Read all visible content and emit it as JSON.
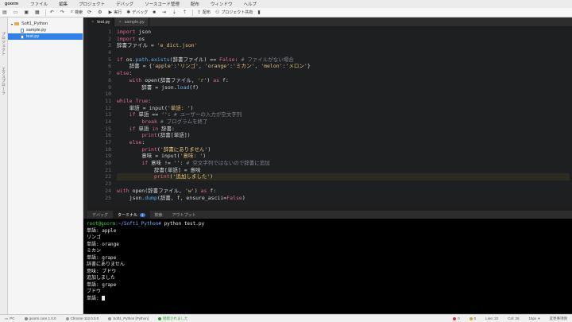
{
  "menubar": {
    "logo": "goorm",
    "items": [
      "ファイル",
      "編集",
      "プロジェクト",
      "デバッグ",
      "ソースコード管理",
      "配布",
      "ウィンドウ",
      "ヘルプ"
    ]
  },
  "toolbar": {
    "search_label": "検索",
    "run_label": "実行",
    "debug_label": "デバッグ",
    "deploy_label": "配布",
    "share_label": "プロジェクト共有"
  },
  "leftrail": {
    "project_label": "プロジェクト",
    "explorer_label": "エクスプローラ"
  },
  "explorer": {
    "folder": "Soft1_Python",
    "files": [
      "sample.py",
      "test.py"
    ],
    "selected": "test.py"
  },
  "editor": {
    "tabs": [
      {
        "label": "test.py"
      },
      {
        "label": "sample.py"
      }
    ],
    "line_numbers": [
      "1",
      "2",
      "3",
      "4",
      "5",
      "6",
      "7",
      "8",
      "9",
      "10",
      "11",
      "12",
      "13",
      "14",
      "15",
      "16",
      "17",
      "18",
      "19",
      "20",
      "21",
      "22",
      "23",
      "24",
      "25"
    ],
    "current_line": 22,
    "lines": [
      [
        {
          "t": "import",
          "c": "k"
        },
        {
          "t": " json",
          "c": "p"
        }
      ],
      [
        {
          "t": "import",
          "c": "k"
        },
        {
          "t": " os",
          "c": "p"
        }
      ],
      [
        {
          "t": "辞書ファイル = ",
          "c": "p"
        },
        {
          "t": "'e_dict.json'",
          "c": "s"
        }
      ],
      [],
      [
        {
          "t": "if",
          "c": "k"
        },
        {
          "t": " os.",
          "c": "p"
        },
        {
          "t": "path",
          "c": "f"
        },
        {
          "t": ".",
          "c": "p"
        },
        {
          "t": "exists",
          "c": "f"
        },
        {
          "t": "(辞書ファイル) == ",
          "c": "p"
        },
        {
          "t": "False",
          "c": "k"
        },
        {
          "t": ": ",
          "c": "p"
        },
        {
          "t": "# ファイルがない場合",
          "c": "c"
        }
      ],
      [
        {
          "t": "    辞書 = {",
          "c": "p"
        },
        {
          "t": "'apple'",
          "c": "s"
        },
        {
          "t": ":",
          "c": "p"
        },
        {
          "t": "'リンゴ'",
          "c": "s"
        },
        {
          "t": ", ",
          "c": "p"
        },
        {
          "t": "'orange'",
          "c": "s"
        },
        {
          "t": ":",
          "c": "p"
        },
        {
          "t": "'ミカン'",
          "c": "s"
        },
        {
          "t": ", ",
          "c": "p"
        },
        {
          "t": "'melon'",
          "c": "s"
        },
        {
          "t": ":",
          "c": "p"
        },
        {
          "t": "'メロン'",
          "c": "s"
        },
        {
          "t": "}",
          "c": "p"
        }
      ],
      [
        {
          "t": "else",
          "c": "k"
        },
        {
          "t": ":",
          "c": "p"
        }
      ],
      [
        {
          "t": "    ",
          "c": "p"
        },
        {
          "t": "with",
          "c": "k"
        },
        {
          "t": " open(辞書ファイル, ",
          "c": "p"
        },
        {
          "t": "'r'",
          "c": "s"
        },
        {
          "t": ") ",
          "c": "p"
        },
        {
          "t": "as",
          "c": "k"
        },
        {
          "t": " f:",
          "c": "p"
        }
      ],
      [
        {
          "t": "        辞書 = json.",
          "c": "p"
        },
        {
          "t": "load",
          "c": "f"
        },
        {
          "t": "(f)",
          "c": "p"
        }
      ],
      [],
      [
        {
          "t": "while",
          "c": "k"
        },
        {
          "t": " ",
          "c": "p"
        },
        {
          "t": "True",
          "c": "k"
        },
        {
          "t": ":",
          "c": "p"
        }
      ],
      [
        {
          "t": "    単語 = input(",
          "c": "p"
        },
        {
          "t": "'単語: '",
          "c": "s"
        },
        {
          "t": ")",
          "c": "p"
        }
      ],
      [
        {
          "t": "    ",
          "c": "p"
        },
        {
          "t": "if",
          "c": "k"
        },
        {
          "t": " 単語 == ",
          "c": "p"
        },
        {
          "t": "''",
          "c": "s"
        },
        {
          "t": ": ",
          "c": "p"
        },
        {
          "t": "# ユーザーの入力が空文字列",
          "c": "c"
        }
      ],
      [
        {
          "t": "        ",
          "c": "p"
        },
        {
          "t": "break",
          "c": "k"
        },
        {
          "t": " ",
          "c": "p"
        },
        {
          "t": "# プログラムを終了",
          "c": "c"
        }
      ],
      [
        {
          "t": "    ",
          "c": "p"
        },
        {
          "t": "if",
          "c": "k"
        },
        {
          "t": " 単語 ",
          "c": "p"
        },
        {
          "t": "in",
          "c": "k"
        },
        {
          "t": " 辞書:",
          "c": "p"
        }
      ],
      [
        {
          "t": "        ",
          "c": "p"
        },
        {
          "t": "print",
          "c": "k"
        },
        {
          "t": "(辞書[単語])",
          "c": "p"
        }
      ],
      [
        {
          "t": "    ",
          "c": "p"
        },
        {
          "t": "else",
          "c": "k"
        },
        {
          "t": ":",
          "c": "p"
        }
      ],
      [
        {
          "t": "        ",
          "c": "p"
        },
        {
          "t": "print",
          "c": "k"
        },
        {
          "t": "(",
          "c": "p"
        },
        {
          "t": "'辞書にありません'",
          "c": "s"
        },
        {
          "t": ")",
          "c": "p"
        }
      ],
      [
        {
          "t": "        意味 = input(",
          "c": "p"
        },
        {
          "t": "'意味: '",
          "c": "s"
        },
        {
          "t": ")",
          "c": "p"
        }
      ],
      [
        {
          "t": "        ",
          "c": "p"
        },
        {
          "t": "if",
          "c": "k"
        },
        {
          "t": " 意味 != ",
          "c": "p"
        },
        {
          "t": "''",
          "c": "s"
        },
        {
          "t": ": ",
          "c": "p"
        },
        {
          "t": "# 空文字列ではないので辞書に追加",
          "c": "c"
        }
      ],
      [
        {
          "t": "            辞書[単語] = 意味",
          "c": "p"
        }
      ],
      [
        {
          "t": "            ",
          "c": "p"
        },
        {
          "t": "print",
          "c": "k"
        },
        {
          "t": "(",
          "c": "p"
        },
        {
          "t": "'追加しました'",
          "c": "s"
        },
        {
          "t": ")",
          "c": "p"
        }
      ],
      [],
      [
        {
          "t": "with",
          "c": "k"
        },
        {
          "t": " open(辞書ファイル, ",
          "c": "p"
        },
        {
          "t": "'w'",
          "c": "s"
        },
        {
          "t": ") ",
          "c": "p"
        },
        {
          "t": "as",
          "c": "k"
        },
        {
          "t": " f:",
          "c": "p"
        }
      ],
      [
        {
          "t": "    json.",
          "c": "p"
        },
        {
          "t": "dump",
          "c": "f"
        },
        {
          "t": "(辞書, f, ensure_ascii=",
          "c": "p"
        },
        {
          "t": "False",
          "c": "k"
        },
        {
          "t": ")",
          "c": "p"
        }
      ]
    ]
  },
  "bottom_panel": {
    "tabs": [
      "デバッグ",
      "ターミナル",
      "検索",
      "アウトプット"
    ],
    "active_tab": "ターミナル",
    "terminal_badge": "1"
  },
  "terminal": {
    "prompt_user": "root@goorm",
    "prompt_path": ":~/Soft1_Python#",
    "command": " python test.py",
    "lines": [
      "単語: apple",
      "リンゴ",
      "単語: orange",
      "ミカン",
      "単語: grape",
      "辞書にありません",
      "意味: ブドウ",
      "追加しました",
      "単語: grape",
      "ブドウ"
    ],
    "last_prompt": "単語: "
  },
  "statusbar": {
    "pc": "PC",
    "goorm_version": "goorm.core 1.0.0",
    "chrome": "Chrome 112.0.0.0",
    "project": "Soft1_Python [Python]",
    "status": "接続されました",
    "errors": "0",
    "warnings": "0",
    "line": "Line: 22",
    "col": "Col: 26",
    "font": "15px",
    "encoding": "変更事項保"
  },
  "colors": {
    "accent": "#2f80ed",
    "keyword": "#e06c8a",
    "string": "#e5c07b",
    "comment": "#7f848e",
    "prompt_green": "#3ad13a",
    "status_ok": "#29a329",
    "error": "#e03030"
  }
}
